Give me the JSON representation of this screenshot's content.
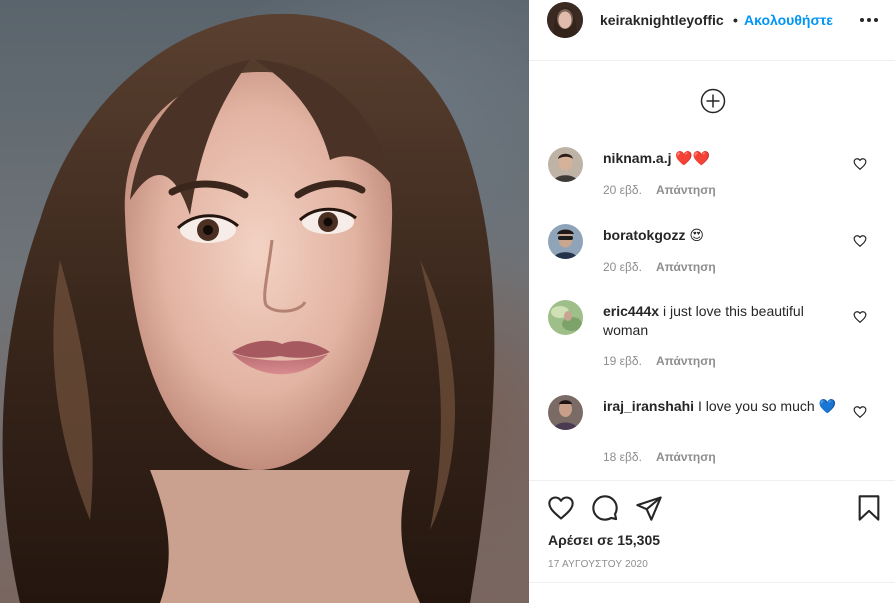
{
  "post": {
    "username": "keiraknightleyoffic",
    "separator": "•",
    "follow_label": "Ακολουθήστε",
    "more_icon": "more-options-icon",
    "load_more_icon": "circle-plus-icon"
  },
  "comments": [
    {
      "username": "niknam.a.j",
      "text": "❤️❤️",
      "time": "20 εβδ.",
      "reply_label": "Απάντηση"
    },
    {
      "username": "boratokgozz",
      "text": "😍",
      "time": "20 εβδ.",
      "reply_label": "Απάντηση"
    },
    {
      "username": "eric444x",
      "text": "i just love this beautiful woman",
      "time": "19 εβδ.",
      "reply_label": "Απάντηση"
    },
    {
      "username": "iraj_iranshahi",
      "text": "I love you so much 💙",
      "time": "18 εβδ.",
      "reply_label": "Απάντηση"
    }
  ],
  "actions": {
    "icons": [
      "heart-icon",
      "comment-icon",
      "share-icon",
      "bookmark-icon"
    ],
    "likes_text": "Αρέσει σε 15,305",
    "date_text": "17 ΑΥΓΟΥΣΤΟΥ 2020"
  },
  "colors": {
    "accent": "#0095f6",
    "text": "#262626",
    "muted": "#8e8e8e",
    "heart_red": "#ed1c24",
    "heart_blue": "#2a8bd8"
  }
}
